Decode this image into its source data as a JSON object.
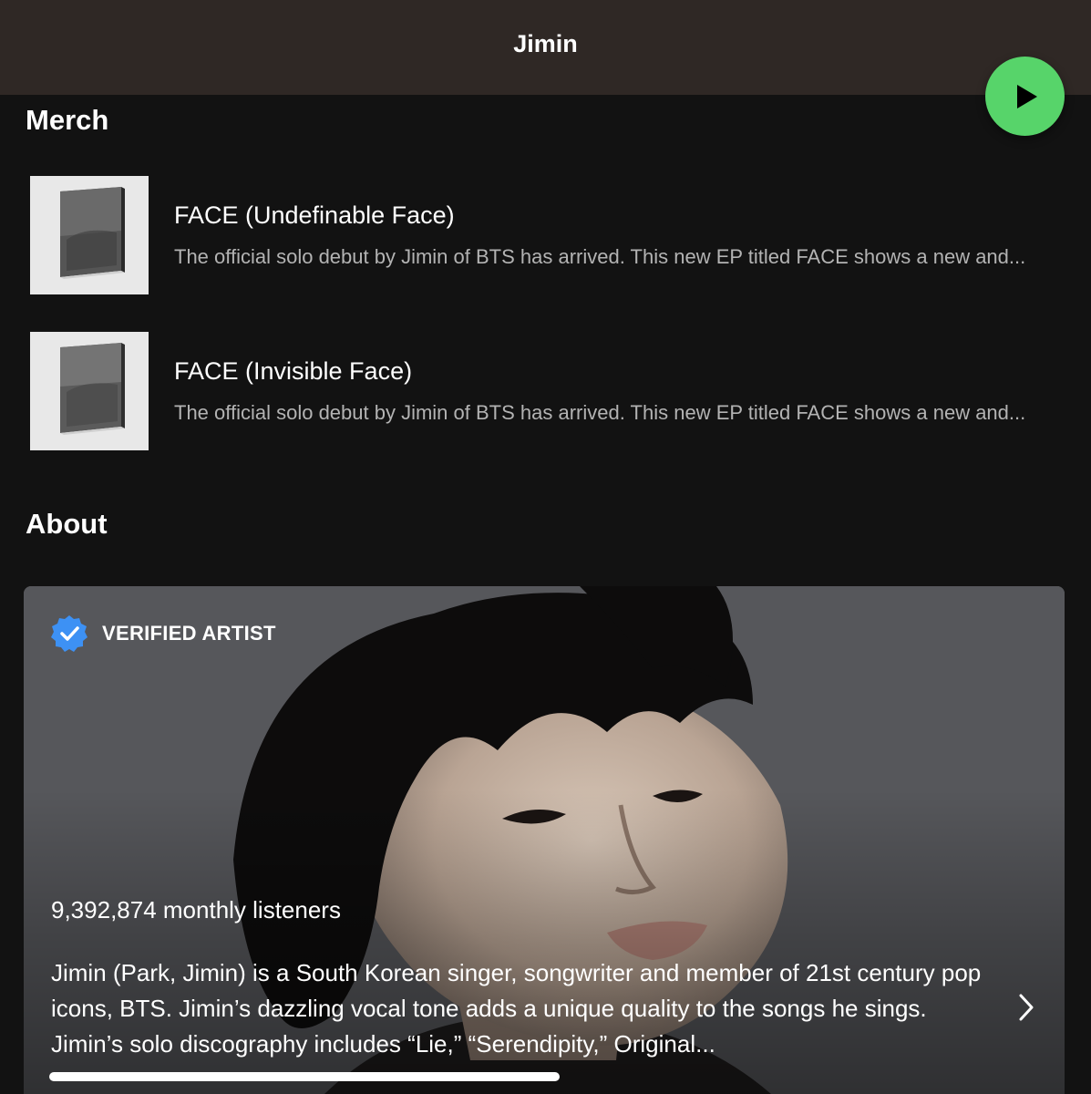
{
  "header": {
    "title": "Jimin"
  },
  "player": {
    "icon": "play-icon",
    "color": "#57d46a"
  },
  "merch": {
    "heading": "Merch",
    "items": [
      {
        "title": "FACE (Undefinable Face)",
        "description": "The official solo debut by Jimin of BTS has arrived. This new EP titled FACE shows a new and..."
      },
      {
        "title": "FACE (Invisible Face)",
        "description": "The official solo debut by Jimin of BTS has arrived. This new EP titled FACE shows a new and..."
      }
    ]
  },
  "about": {
    "heading": "About",
    "verified_label": "VERIFIED ARTIST",
    "verified_icon": "verified-badge-icon",
    "verified_color": "#3d91f4",
    "monthly_listeners": "9,392,874 monthly listeners",
    "bio": "Jimin (Park, Jimin) is a South Korean singer, songwriter and member of 21st century pop icons, BTS. Jimin’s dazzling vocal tone adds a unique quality to the songs he sings. Jimin’s solo discography includes “Lie,” “Serendipity,” Original...",
    "expand_icon": "chevron-right-icon"
  }
}
